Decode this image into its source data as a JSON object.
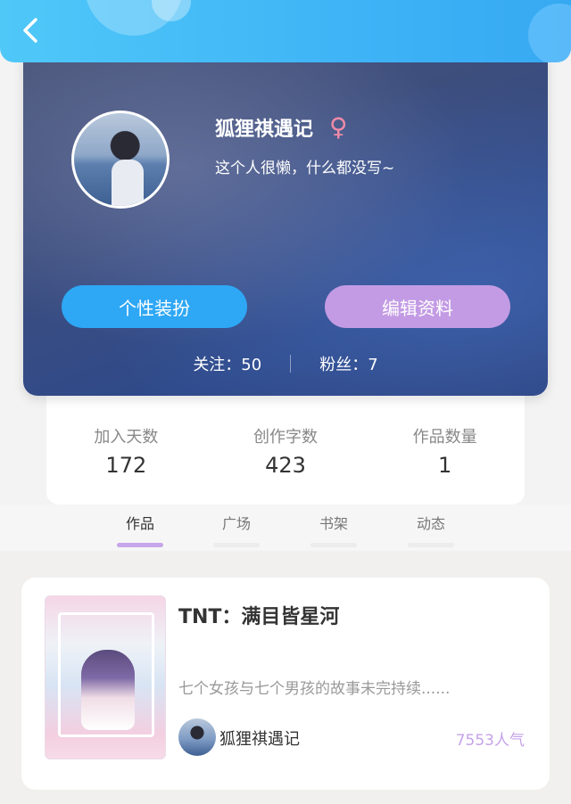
{
  "header": {
    "back_icon": "chevron-left-icon"
  },
  "profile": {
    "username": "狐狸祺遇记",
    "gender_symbol": "♀",
    "bio": "这个人很懒，什么都没写~",
    "dress_button": "个性装扮",
    "edit_button": "编辑资料",
    "following": "关注：50",
    "followers": "粉丝：7"
  },
  "stats": [
    {
      "label": "加入天数",
      "value": "172"
    },
    {
      "label": "创作字数",
      "value": "423"
    },
    {
      "label": "作品数量",
      "value": "1"
    }
  ],
  "tabs": [
    {
      "label": "作品",
      "active": true
    },
    {
      "label": "广场",
      "active": false
    },
    {
      "label": "书架",
      "active": false
    },
    {
      "label": "动态",
      "active": false
    }
  ],
  "work": {
    "title": "TNT：满目皆星河",
    "description": "七个女孩与七个男孩的故事未完持续......",
    "author": "狐狸祺遇记",
    "popularity": "7553人气"
  },
  "colors": {
    "topbar": "#3fb4f6",
    "dress_button": "#2ea7f5",
    "edit_button": "#c39be4",
    "accent": "#c5a3e8",
    "gender": "#f08aa8"
  }
}
